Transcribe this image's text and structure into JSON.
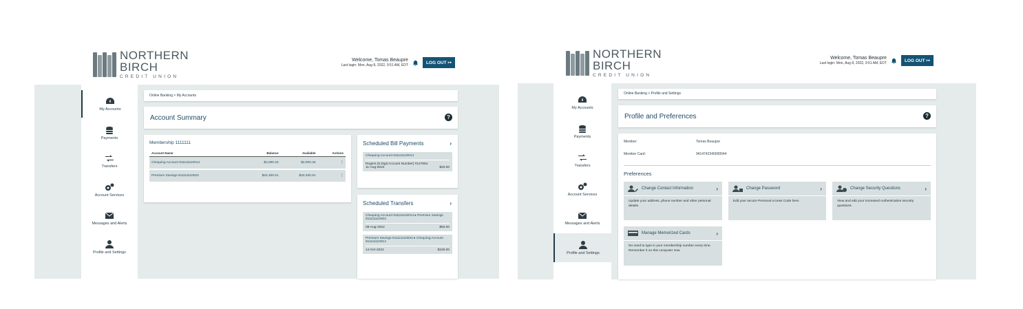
{
  "brand": {
    "line1": "NORTHERN",
    "line2": "BIRCH",
    "line3": "CREDIT UNION"
  },
  "header": {
    "welcome": "Welcome, Tomas Beaupre",
    "last_login": "Last login: Mon, Aug 8, 2022, 9:51 AM, EDT",
    "logout_label": "LOG OUT"
  },
  "nav": [
    {
      "label": "My Accounts",
      "icon": "speedometer-icon"
    },
    {
      "label": "Payments",
      "icon": "coins-icon"
    },
    {
      "label": "Transfers",
      "icon": "transfer-arrows-icon"
    },
    {
      "label": "Account Services",
      "icon": "gears-icon"
    },
    {
      "label": "Messages and Alerts",
      "icon": "envelope-icon"
    },
    {
      "label": "Profile and Settings",
      "icon": "person-icon"
    }
  ],
  "left": {
    "breadcrumb": "Online Banking  >  My Accounts",
    "title": "Account Summary",
    "membership": "Membership 1111111",
    "columns": [
      "Account Name",
      "Balance",
      "Available",
      "Actions"
    ],
    "accounts": [
      {
        "name": "Chequing Account 911111110014",
        "balance": "$2,000.34",
        "available": "$2,000.34"
      },
      {
        "name": "Premium Savings 911111110022",
        "balance": "$32,400.51",
        "available": "$32,400.51"
      }
    ],
    "bill_payments": {
      "title": "Scheduled Bill Payments",
      "account": "Chequing Account 911111110014",
      "payee": "Rogers (6 Digit Account Number)  #127654",
      "date": "11-Aug-2022",
      "amount": "$20.00"
    },
    "transfers": {
      "title": "Scheduled Transfers",
      "items": [
        {
          "route": "Chequing Account 911111110014 ▸ Premium Savings 911111110022",
          "date": "08-Aug-2022",
          "amount": "$50.00"
        },
        {
          "route": "Premium Savings 911111110022 ▸  Chequing Account 911111110014",
          "date": "14-Oct-2022",
          "amount": "$100.00"
        }
      ]
    }
  },
  "right": {
    "breadcrumb": "Online Banking  >  Profile and Settings",
    "title": "Profile and Preferences",
    "member_label": "Member:",
    "member_value": "Tomas Beaupre",
    "card_label": "Member Card:",
    "card_value": "9414742340000044",
    "prefs_heading": "Preferences",
    "prefs": [
      {
        "title": "Change Contact Information",
        "desc": "Update your address, phone number and other personal details.",
        "icon": "person-edit-icon"
      },
      {
        "title": "Change Password",
        "desc": "Edit your secure Personal Access Code here.",
        "icon": "person-lock-icon"
      },
      {
        "title": "Change Security Questions",
        "desc": "View and edit your Increased Authentication security questions.",
        "icon": "person-question-icon"
      },
      {
        "title": "Manage Memorized Cards",
        "desc": "No need to type in your membership number every time. Remember it on this computer now.",
        "icon": "card-icon"
      }
    ]
  }
}
